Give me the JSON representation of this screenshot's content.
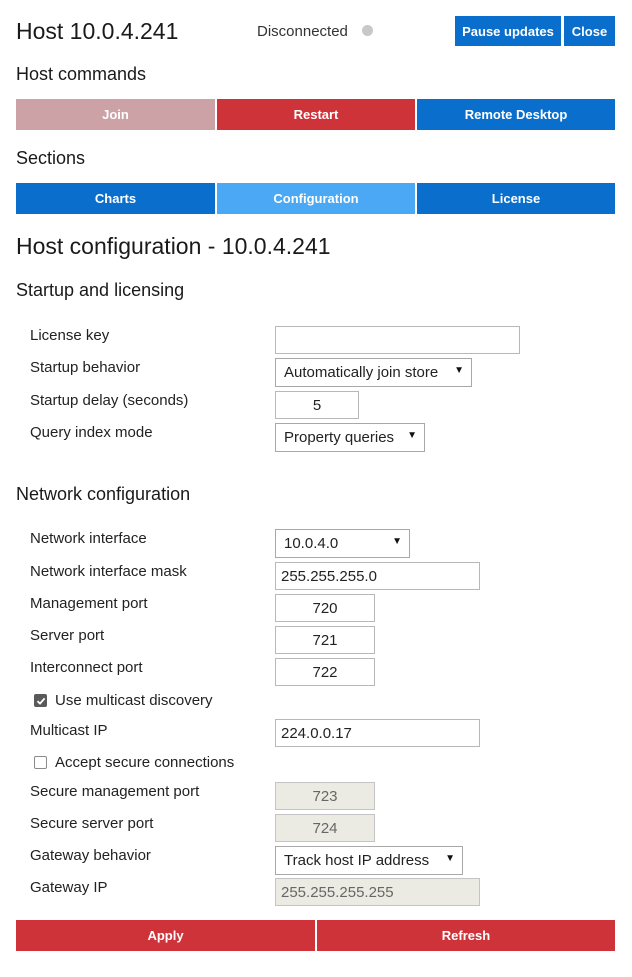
{
  "header": {
    "title": "Host 10.0.4.241",
    "status": "Disconnected",
    "status_color": "#c8c8c8",
    "pause_label": "Pause updates",
    "close_label": "Close"
  },
  "host_commands": {
    "heading": "Host commands",
    "join_label": "Join",
    "restart_label": "Restart",
    "remote_desktop_label": "Remote Desktop"
  },
  "sections": {
    "heading": "Sections",
    "tabs": [
      {
        "label": "Charts"
      },
      {
        "label": "Configuration"
      },
      {
        "label": "License"
      }
    ]
  },
  "config": {
    "heading": "Host configuration - 10.0.4.241",
    "startup": {
      "heading": "Startup and licensing",
      "license_key_label": "License key",
      "license_key_value": "",
      "startup_behavior_label": "Startup behavior",
      "startup_behavior_value": "Automatically join store",
      "startup_delay_label": "Startup delay (seconds)",
      "startup_delay_value": "5",
      "query_index_label": "Query index mode",
      "query_index_value": "Property queries"
    },
    "network": {
      "heading": "Network configuration",
      "interface_label": "Network interface",
      "interface_value": "10.0.4.0",
      "mask_label": "Network interface mask",
      "mask_value": "255.255.255.0",
      "mgmt_port_label": "Management port",
      "mgmt_port_value": "720",
      "server_port_label": "Server port",
      "server_port_value": "721",
      "interconnect_port_label": "Interconnect port",
      "interconnect_port_value": "722",
      "multicast_checkbox_label": "Use multicast discovery",
      "multicast_checked": true,
      "multicast_ip_label": "Multicast IP",
      "multicast_ip_value": "224.0.0.17",
      "secure_checkbox_label": "Accept secure connections",
      "secure_checked": false,
      "secure_mgmt_port_label": "Secure management port",
      "secure_mgmt_port_value": "723",
      "secure_server_port_label": "Secure server port",
      "secure_server_port_value": "724",
      "gateway_behavior_label": "Gateway behavior",
      "gateway_behavior_value": "Track host IP address",
      "gateway_ip_label": "Gateway IP",
      "gateway_ip_value": "255.255.255.255"
    }
  },
  "footer": {
    "apply_label": "Apply",
    "refresh_label": "Refresh"
  },
  "colors": {
    "primary_blue": "#0a6fcc",
    "active_tab": "#4aa8f5",
    "danger_red": "#cf333a",
    "disabled_pink": "#cca2a7"
  }
}
